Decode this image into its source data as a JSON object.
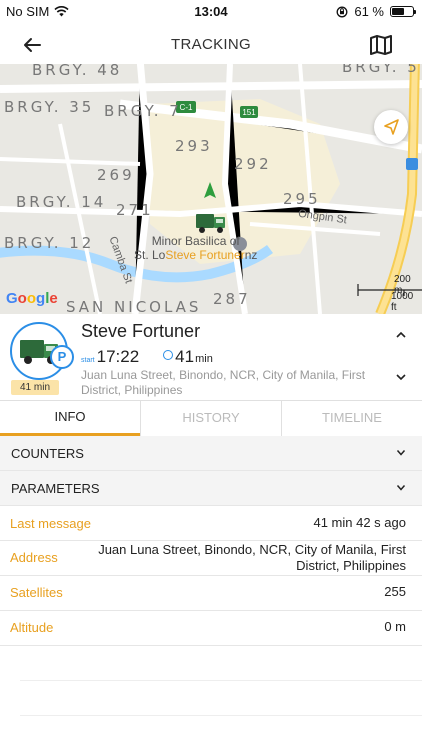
{
  "status_bar": {
    "carrier": "No SIM",
    "time": "13:04",
    "battery_text": "61 %",
    "battery_level": 0.61,
    "icons": [
      "wifi-icon",
      "orientation-lock-icon",
      "battery-icon"
    ]
  },
  "nav": {
    "title": "TRACKING",
    "back_icon": "arrow-left-icon",
    "map_icon": "map-icon"
  },
  "map": {
    "area_labels": [
      "BRGY. 48",
      "BRGY. 35",
      "BRGY. 7",
      "BRGY. 14",
      "BRGY. 12",
      "SAN NICOLAS",
      "BRGY. 5"
    ],
    "block_numbers": [
      "293",
      "292",
      "269",
      "271",
      "295",
      "287"
    ],
    "road_shields": [
      "C-1",
      "151"
    ],
    "street_labels": [
      "Ongpin St",
      "Camba St"
    ],
    "poi_name_line1": "Minor Basilica of",
    "poi_name_line2": "St. Lo",
    "unit_label": "Steve Fortuner",
    "poi_name_tail": "nz",
    "scale_metric": "200 m",
    "scale_imperial": "1000 ft",
    "logo_text": "Google",
    "logo_colors": [
      "#4285F4",
      "#EA4335",
      "#FBBC05",
      "#4285F4",
      "#34A853",
      "#EA4335"
    ]
  },
  "unit": {
    "name": "Steve Fortuner",
    "start_label": "start",
    "start_time": "17:22",
    "duration_value": "41",
    "duration_unit": "min",
    "badge_duration": "41 min",
    "parking_symbol": "P",
    "address": "Juan Luna Street, Binondo, NCR, City of Manila, First District, Philippines"
  },
  "tabs": [
    {
      "label": "INFO",
      "active": true
    },
    {
      "label": "HISTORY",
      "active": false
    },
    {
      "label": "TIMELINE",
      "active": false
    }
  ],
  "sections": {
    "counters": "COUNTERS",
    "parameters": "PARAMETERS"
  },
  "properties": [
    {
      "key": "Last message",
      "value": "41 min 42 s ago"
    },
    {
      "key": "Address",
      "value": "Juan Luna Street, Binondo, NCR, City of Manila, First District, Philippines"
    },
    {
      "key": "Satellites",
      "value": "255"
    },
    {
      "key": "Altitude",
      "value": "0 m"
    }
  ],
  "colors": {
    "accent": "#e8a020",
    "primary": "#2b8ee6",
    "badge_bg": "#fbe3a8"
  }
}
